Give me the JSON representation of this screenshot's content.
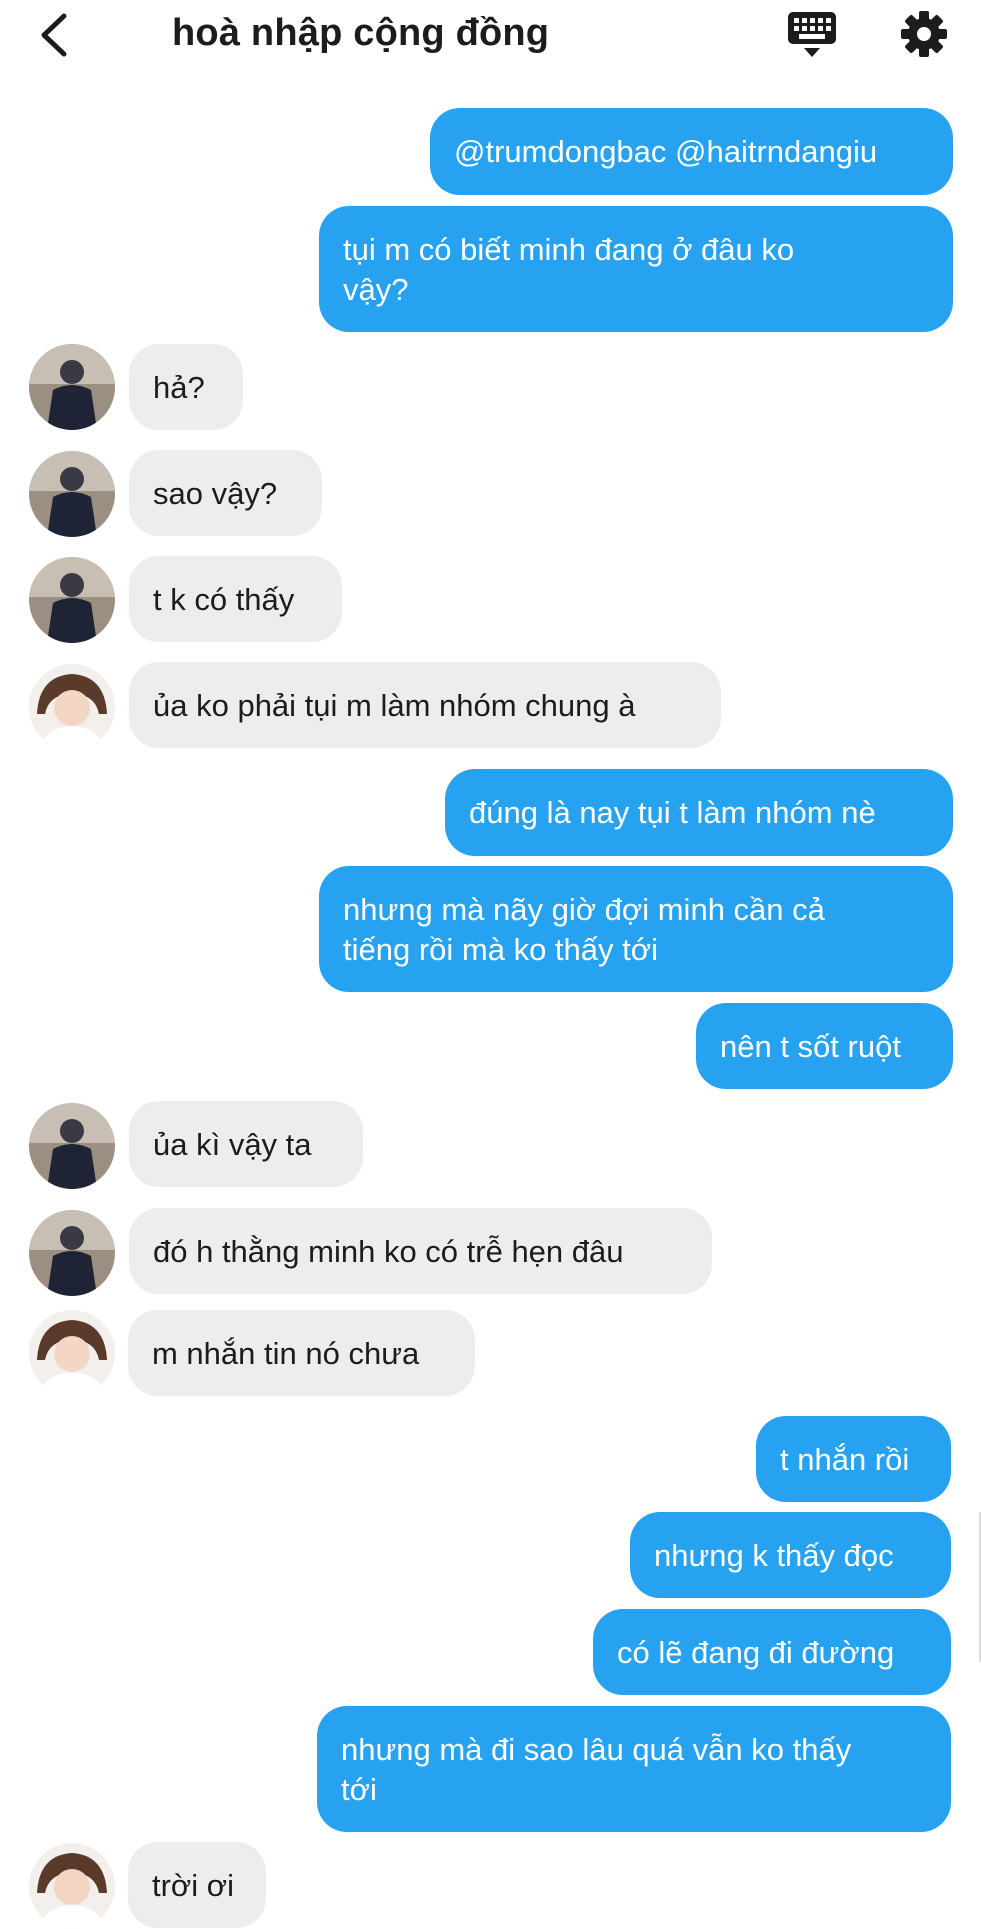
{
  "header": {
    "title": "hoà nhập cộng đồng"
  },
  "colors": {
    "outgoing": "#27a2f0",
    "incoming": "#ededef",
    "text": "#1c1c1e"
  },
  "messages": [
    {
      "direction": "outgoing",
      "text": "@trumdongbac @haitrndangiu"
    },
    {
      "direction": "outgoing",
      "text": "tụi m có biết minh đang ở đâu ko\nvậy?"
    },
    {
      "direction": "incoming",
      "avatar": "avatar-a",
      "text": "hả?"
    },
    {
      "direction": "incoming",
      "avatar": "avatar-a",
      "text": "sao vậy?"
    },
    {
      "direction": "incoming",
      "avatar": "avatar-a",
      "text": "t k có thấy"
    },
    {
      "direction": "incoming",
      "avatar": "avatar-b",
      "text": "ủa ko phải tụi m làm nhóm chung à"
    },
    {
      "direction": "outgoing",
      "text": "đúng là nay tụi t làm nhóm nè"
    },
    {
      "direction": "outgoing",
      "text": "nhưng mà nãy giờ đợi minh cần cả\ntiếng rồi mà ko thấy tới"
    },
    {
      "direction": "outgoing",
      "text": "nên t sốt ruột"
    },
    {
      "direction": "incoming",
      "avatar": "avatar-a",
      "text": "ủa kì vậy ta"
    },
    {
      "direction": "incoming",
      "avatar": "avatar-a",
      "text": "đó h thằng minh ko có trễ hẹn đâu"
    },
    {
      "direction": "incoming",
      "avatar": "avatar-b",
      "text": "m nhắn tin nó chưa"
    },
    {
      "direction": "outgoing",
      "text": "t nhắn rồi"
    },
    {
      "direction": "outgoing",
      "text": "nhưng k thấy đọc"
    },
    {
      "direction": "outgoing",
      "text": "có lẽ đang đi đường"
    },
    {
      "direction": "outgoing",
      "text": "nhưng mà đi sao lâu quá vẫn ko thấy\ntới"
    },
    {
      "direction": "incoming",
      "avatar": "avatar-b",
      "text": "trời ơi"
    }
  ]
}
